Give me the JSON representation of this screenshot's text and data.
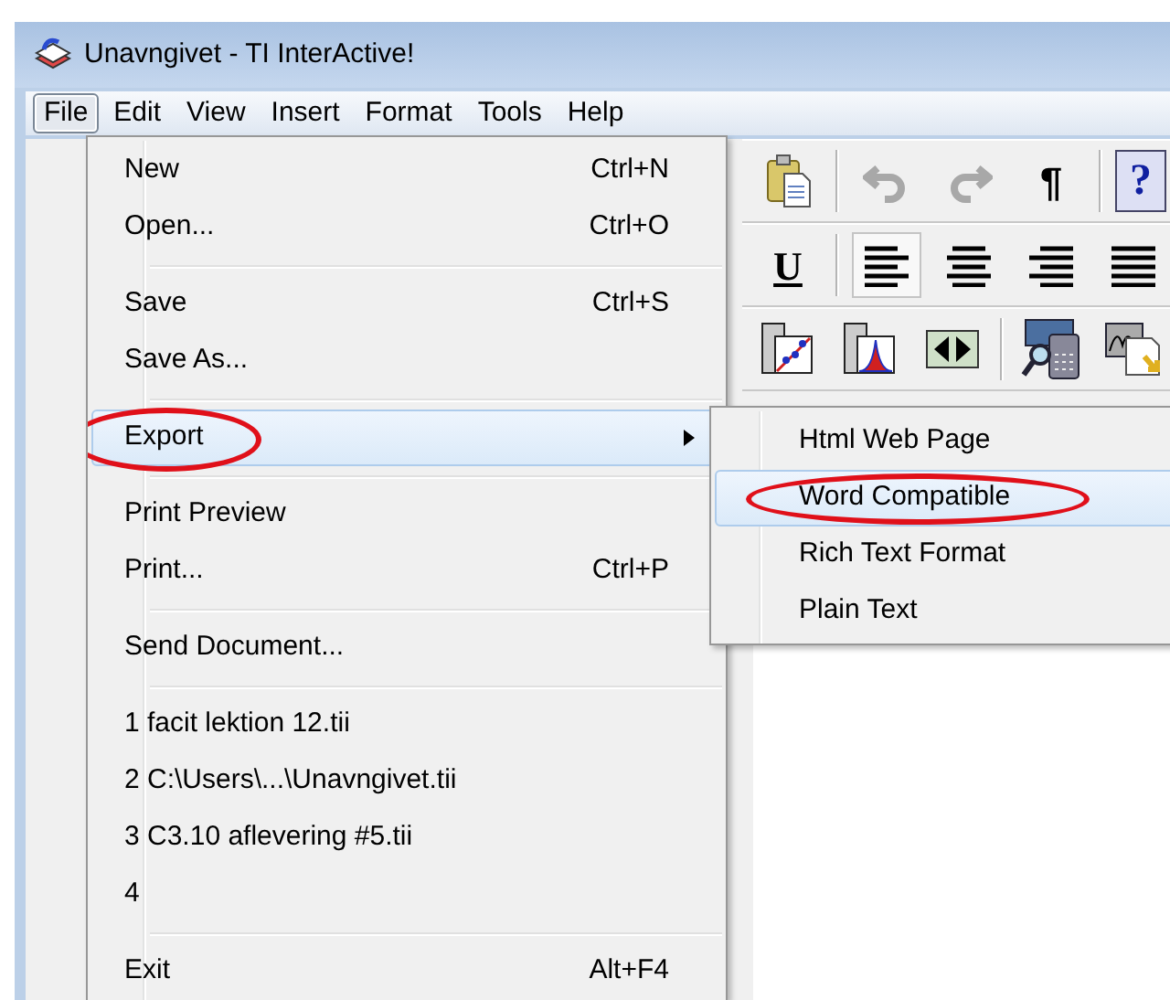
{
  "window": {
    "title": "Unavngivet - TI InterActive!"
  },
  "menubar": [
    {
      "label": "File",
      "selected": true
    },
    {
      "label": "Edit",
      "selected": false
    },
    {
      "label": "View",
      "selected": false
    },
    {
      "label": "Insert",
      "selected": false
    },
    {
      "label": "Format",
      "selected": false
    },
    {
      "label": "Tools",
      "selected": false
    },
    {
      "label": "Help",
      "selected": false
    }
  ],
  "toolbars": [
    [
      {
        "kind": "paste"
      },
      {
        "kind": "separator"
      },
      {
        "kind": "undo",
        "disabled": true
      },
      {
        "kind": "redo",
        "disabled": true
      },
      {
        "kind": "text",
        "label": "¶",
        "pressed": false
      },
      {
        "kind": "separator"
      },
      {
        "kind": "help",
        "label": "?"
      }
    ],
    [
      {
        "kind": "underline",
        "label": "U",
        "pressed": false
      },
      {
        "kind": "separator"
      },
      {
        "kind": "align-left",
        "pressed": true
      },
      {
        "kind": "align-center",
        "pressed": false
      },
      {
        "kind": "align-right",
        "pressed": false
      },
      {
        "kind": "justify",
        "pressed": false
      }
    ],
    [
      {
        "kind": "scatter-chart"
      },
      {
        "kind": "bell-chart"
      },
      {
        "kind": "slider"
      },
      {
        "kind": "separator"
      },
      {
        "kind": "calculator"
      },
      {
        "kind": "graph-doc"
      }
    ]
  ],
  "file_menu": [
    {
      "kind": "item",
      "label": "New",
      "shortcut": "Ctrl+N",
      "highlighted": false,
      "circled": false
    },
    {
      "kind": "item",
      "label": "Open...",
      "shortcut": "Ctrl+O",
      "highlighted": false,
      "circled": false
    },
    {
      "kind": "separator"
    },
    {
      "kind": "item",
      "label": "Save",
      "shortcut": "Ctrl+S",
      "highlighted": false,
      "circled": false
    },
    {
      "kind": "item",
      "label": "Save As...",
      "highlighted": false,
      "circled": false
    },
    {
      "kind": "separator"
    },
    {
      "kind": "submenu",
      "label": "Export",
      "highlighted": true,
      "circled": true
    },
    {
      "kind": "separator"
    },
    {
      "kind": "item",
      "label": "Print Preview",
      "highlighted": false,
      "circled": false
    },
    {
      "kind": "item",
      "label": "Print...",
      "shortcut": "Ctrl+P",
      "highlighted": false,
      "circled": false
    },
    {
      "kind": "separator"
    },
    {
      "kind": "item",
      "label": "Send Document...",
      "highlighted": false,
      "circled": false
    },
    {
      "kind": "separator"
    },
    {
      "kind": "item",
      "label": "1 facit lektion 12.tii",
      "highlighted": false,
      "circled": false
    },
    {
      "kind": "item",
      "label": "2 C:\\Users\\...\\Unavngivet.tii",
      "highlighted": false,
      "circled": false
    },
    {
      "kind": "item",
      "label": "3 C3.10 aflevering #5.tii",
      "highlighted": false,
      "circled": false
    },
    {
      "kind": "item",
      "label": "4",
      "highlighted": false,
      "circled": false
    },
    {
      "kind": "separator"
    },
    {
      "kind": "item",
      "label": "Exit",
      "shortcut": "Alt+F4",
      "highlighted": false,
      "circled": false
    }
  ],
  "export_submenu": [
    {
      "label": "Html Web Page",
      "highlighted": false,
      "circled": false
    },
    {
      "label": "Word Compatible",
      "highlighted": true,
      "circled": true
    },
    {
      "label": "Rich Text Format",
      "highlighted": false,
      "circled": false
    },
    {
      "label": "Plain Text",
      "highlighted": false,
      "circled": false
    }
  ]
}
